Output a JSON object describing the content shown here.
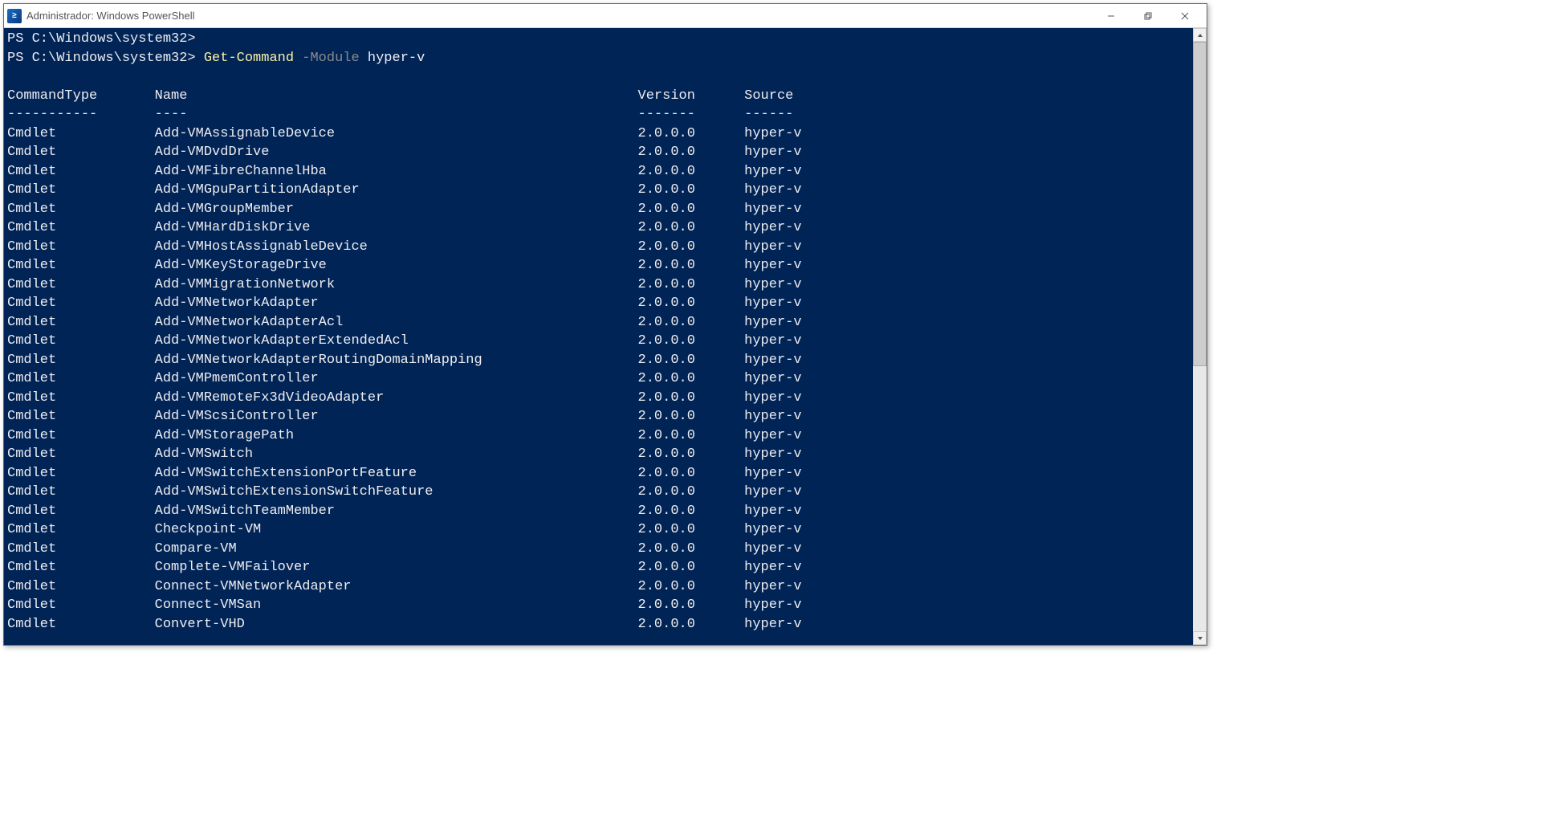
{
  "title": "Administrador: Windows PowerShell",
  "app_icon_glyph": "≥",
  "prompt": "PS C:\\Windows\\system32>",
  "command": {
    "cmdlet": "Get-Command",
    "param": "-Module",
    "arg": "hyper-v"
  },
  "headers": {
    "type": "CommandType",
    "name": "Name",
    "version": "Version",
    "source": "Source"
  },
  "underlines": {
    "type": "-----------",
    "name": "----",
    "version": "-------",
    "source": "------"
  },
  "rows": [
    {
      "type": "Cmdlet",
      "name": "Add-VMAssignableDevice",
      "version": "2.0.0.0",
      "source": "hyper-v"
    },
    {
      "type": "Cmdlet",
      "name": "Add-VMDvdDrive",
      "version": "2.0.0.0",
      "source": "hyper-v"
    },
    {
      "type": "Cmdlet",
      "name": "Add-VMFibreChannelHba",
      "version": "2.0.0.0",
      "source": "hyper-v"
    },
    {
      "type": "Cmdlet",
      "name": "Add-VMGpuPartitionAdapter",
      "version": "2.0.0.0",
      "source": "hyper-v"
    },
    {
      "type": "Cmdlet",
      "name": "Add-VMGroupMember",
      "version": "2.0.0.0",
      "source": "hyper-v"
    },
    {
      "type": "Cmdlet",
      "name": "Add-VMHardDiskDrive",
      "version": "2.0.0.0",
      "source": "hyper-v"
    },
    {
      "type": "Cmdlet",
      "name": "Add-VMHostAssignableDevice",
      "version": "2.0.0.0",
      "source": "hyper-v"
    },
    {
      "type": "Cmdlet",
      "name": "Add-VMKeyStorageDrive",
      "version": "2.0.0.0",
      "source": "hyper-v"
    },
    {
      "type": "Cmdlet",
      "name": "Add-VMMigrationNetwork",
      "version": "2.0.0.0",
      "source": "hyper-v"
    },
    {
      "type": "Cmdlet",
      "name": "Add-VMNetworkAdapter",
      "version": "2.0.0.0",
      "source": "hyper-v"
    },
    {
      "type": "Cmdlet",
      "name": "Add-VMNetworkAdapterAcl",
      "version": "2.0.0.0",
      "source": "hyper-v"
    },
    {
      "type": "Cmdlet",
      "name": "Add-VMNetworkAdapterExtendedAcl",
      "version": "2.0.0.0",
      "source": "hyper-v"
    },
    {
      "type": "Cmdlet",
      "name": "Add-VMNetworkAdapterRoutingDomainMapping",
      "version": "2.0.0.0",
      "source": "hyper-v"
    },
    {
      "type": "Cmdlet",
      "name": "Add-VMPmemController",
      "version": "2.0.0.0",
      "source": "hyper-v"
    },
    {
      "type": "Cmdlet",
      "name": "Add-VMRemoteFx3dVideoAdapter",
      "version": "2.0.0.0",
      "source": "hyper-v"
    },
    {
      "type": "Cmdlet",
      "name": "Add-VMScsiController",
      "version": "2.0.0.0",
      "source": "hyper-v"
    },
    {
      "type": "Cmdlet",
      "name": "Add-VMStoragePath",
      "version": "2.0.0.0",
      "source": "hyper-v"
    },
    {
      "type": "Cmdlet",
      "name": "Add-VMSwitch",
      "version": "2.0.0.0",
      "source": "hyper-v"
    },
    {
      "type": "Cmdlet",
      "name": "Add-VMSwitchExtensionPortFeature",
      "version": "2.0.0.0",
      "source": "hyper-v"
    },
    {
      "type": "Cmdlet",
      "name": "Add-VMSwitchExtensionSwitchFeature",
      "version": "2.0.0.0",
      "source": "hyper-v"
    },
    {
      "type": "Cmdlet",
      "name": "Add-VMSwitchTeamMember",
      "version": "2.0.0.0",
      "source": "hyper-v"
    },
    {
      "type": "Cmdlet",
      "name": "Checkpoint-VM",
      "version": "2.0.0.0",
      "source": "hyper-v"
    },
    {
      "type": "Cmdlet",
      "name": "Compare-VM",
      "version": "2.0.0.0",
      "source": "hyper-v"
    },
    {
      "type": "Cmdlet",
      "name": "Complete-VMFailover",
      "version": "2.0.0.0",
      "source": "hyper-v"
    },
    {
      "type": "Cmdlet",
      "name": "Connect-VMNetworkAdapter",
      "version": "2.0.0.0",
      "source": "hyper-v"
    },
    {
      "type": "Cmdlet",
      "name": "Connect-VMSan",
      "version": "2.0.0.0",
      "source": "hyper-v"
    },
    {
      "type": "Cmdlet",
      "name": "Convert-VHD",
      "version": "2.0.0.0",
      "source": "hyper-v"
    }
  ],
  "columns": {
    "type_w": 18,
    "name_w": 59,
    "version_w": 13
  }
}
